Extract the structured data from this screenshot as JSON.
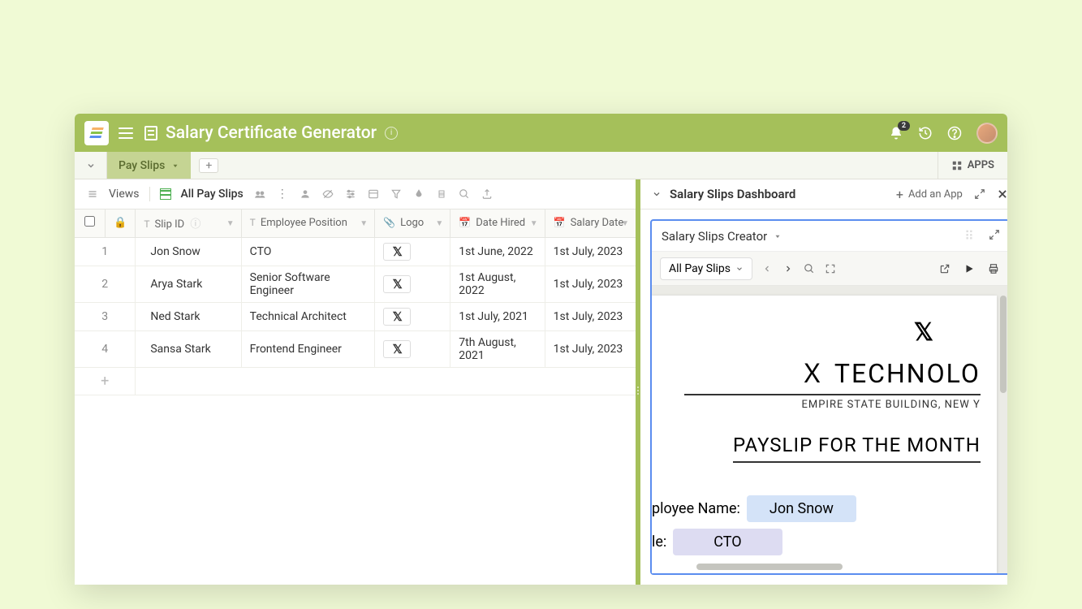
{
  "header": {
    "title": "Salary Certificate Generator",
    "notification_count": "2"
  },
  "tabs": {
    "active": "Pay Slips",
    "apps_label": "APPS"
  },
  "toolbar": {
    "views_label": "Views",
    "view_name": "All Pay Slips"
  },
  "columns": {
    "slip_id": "Slip ID",
    "position": "Employee Position",
    "logo": "Logo",
    "date_hired": "Date Hired",
    "salary_date": "Salary Date"
  },
  "rows": [
    {
      "num": "1",
      "slip_id": "Jon Snow",
      "position": "CTO",
      "date_hired": "1st June, 2022",
      "salary_date": "1st July, 2023"
    },
    {
      "num": "2",
      "slip_id": "Arya Stark",
      "position": "Senior Software Engineer",
      "date_hired": "1st August, 2022",
      "salary_date": "1st July, 2023"
    },
    {
      "num": "3",
      "slip_id": "Ned Stark",
      "position": "Technical Architect",
      "date_hired": "1st July, 2021",
      "salary_date": "1st July, 2023"
    },
    {
      "num": "4",
      "slip_id": "Sansa Stark",
      "position": "Frontend Engineer",
      "date_hired": "7th August, 2021",
      "salary_date": "1st July, 2023"
    }
  ],
  "dashboard": {
    "title": "Salary Slips Dashboard",
    "add_app": "Add an App",
    "panel_title": "Salary Slips Creator",
    "filter": "All Pay Slips"
  },
  "payslip": {
    "company_name": "Ｘ TECHNOLO",
    "company_addr": "EMPIRE STATE BUILDING, NEW Y",
    "title": "PAYSLIP FOR THE MONTH",
    "emp_name_label": "ployee Name:",
    "emp_name_value": "Jon Snow",
    "title_label": "le:",
    "title_value": "CTO"
  }
}
